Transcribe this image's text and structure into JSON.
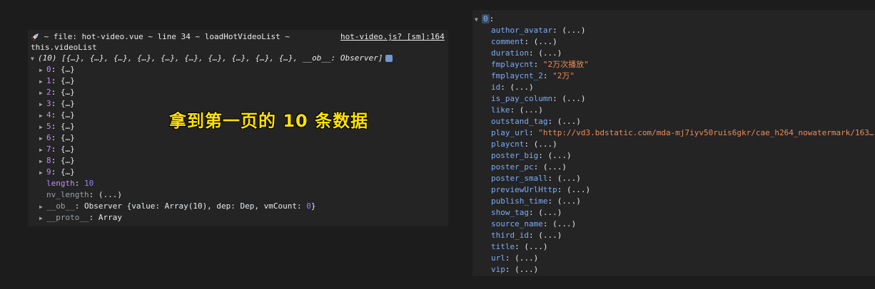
{
  "left_console": {
    "header": {
      "rocket_icon": "rocket-icon",
      "log_text": " ~ file: hot-video.vue ~ line 34 ~ loadHotVideoList ~",
      "log_text_2": "this.videoList",
      "source_link": "hot-video.js? [sm]:164"
    },
    "array_summary": "(10) [{…}, {…}, {…}, {…}, {…}, {…}, {…}, {…}, {…}, {…}, __ob__: Observer]",
    "items": [
      {
        "key": "0",
        "value": "{…}"
      },
      {
        "key": "1",
        "value": "{…}"
      },
      {
        "key": "2",
        "value": "{…}"
      },
      {
        "key": "3",
        "value": "{…}"
      },
      {
        "key": "4",
        "value": "{…}"
      },
      {
        "key": "5",
        "value": "{…}"
      },
      {
        "key": "6",
        "value": "{…}"
      },
      {
        "key": "7",
        "value": "{…}"
      },
      {
        "key": "8",
        "value": "{…}"
      },
      {
        "key": "9",
        "value": "{…}"
      }
    ],
    "length_key": "length",
    "length_value": "10",
    "nv_length_key": "nv_length",
    "nv_length_value": "(...)",
    "ob_key": "__ob__",
    "ob_value_prefix": "Observer {value: Array(10), dep: Dep, vmCount: ",
    "ob_value_num": "0",
    "ob_value_suffix": "}",
    "proto_key": "__proto__",
    "proto_value": "Array",
    "overlay_text": "拿到第一页的 10 条数据"
  },
  "right_console": {
    "root_key": "0",
    "fields": [
      {
        "key": "author_avatar",
        "value": "(...)",
        "type": "lazy"
      },
      {
        "key": "comment",
        "value": "(...)",
        "type": "lazy"
      },
      {
        "key": "duration",
        "value": "(...)",
        "type": "lazy"
      },
      {
        "key": "fmplaycnt",
        "value": "\"2万次播放\"",
        "type": "string"
      },
      {
        "key": "fmplaycnt_2",
        "value": "\"2万\"",
        "type": "string"
      },
      {
        "key": "id",
        "value": "(...)",
        "type": "lazy"
      },
      {
        "key": "is_pay_column",
        "value": "(...)",
        "type": "lazy"
      },
      {
        "key": "like",
        "value": "(...)",
        "type": "lazy"
      },
      {
        "key": "outstand_tag",
        "value": "(...)",
        "type": "lazy"
      },
      {
        "key": "play_url",
        "value": "\"http://vd3.bdstatic.com/mda-mj7iyv50ruis6gkr/cae_h264_nowatermark/163…",
        "type": "string"
      },
      {
        "key": "playcnt",
        "value": "(...)",
        "type": "lazy"
      },
      {
        "key": "poster_big",
        "value": "(...)",
        "type": "lazy"
      },
      {
        "key": "poster_pc",
        "value": "(...)",
        "type": "lazy"
      },
      {
        "key": "poster_small",
        "value": "(...)",
        "type": "lazy"
      },
      {
        "key": "previewUrlHttp",
        "value": "(...)",
        "type": "lazy"
      },
      {
        "key": "publish_time",
        "value": "(...)",
        "type": "lazy"
      },
      {
        "key": "show_tag",
        "value": "(...)",
        "type": "lazy"
      },
      {
        "key": "source_name",
        "value": "(...)",
        "type": "lazy"
      },
      {
        "key": "third_id",
        "value": "(...)",
        "type": "lazy"
      },
      {
        "key": "title",
        "value": "(...)",
        "type": "lazy"
      },
      {
        "key": "url",
        "value": "(...)",
        "type": "lazy"
      },
      {
        "key": "vip",
        "value": "(...)",
        "type": "lazy"
      }
    ]
  },
  "colors": {
    "background": "#1c1c1c",
    "panel": "#242424",
    "key_purple": "#c58af9",
    "key_blue": "#7cacf8",
    "string": "#f28b54",
    "number": "#9980ff",
    "overlay_yellow": "#ffe100"
  }
}
